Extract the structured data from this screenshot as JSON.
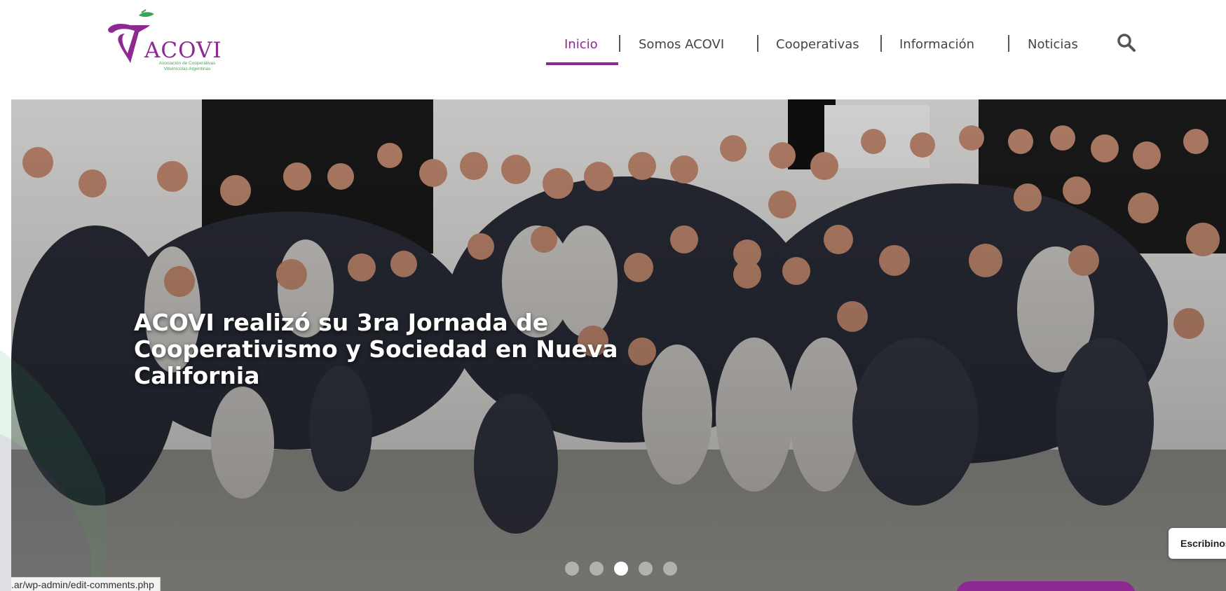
{
  "brand": {
    "name": "ACOVI",
    "subtitle_line1": "Asociación de Cooperativas",
    "subtitle_line2": "Vitivinícolas Argentinas",
    "accent_color": "#8d2a92",
    "leaf_color": "#3aa55a"
  },
  "nav": {
    "items": [
      {
        "label": "Inicio",
        "active": true
      },
      {
        "label": "Somos ACOVI",
        "active": false
      },
      {
        "label": "Cooperativas",
        "active": false
      },
      {
        "label": "Información",
        "active": false
      },
      {
        "label": "Noticias",
        "active": false
      }
    ],
    "separator": "|",
    "search_icon": "search-icon"
  },
  "hero": {
    "title": "ACOVI realizó su 3ra Jornada de Cooperativismo y Sociedad en Nueva California",
    "slides_total": 5,
    "active_slide": 3
  },
  "status_bar": {
    "url": ".ar/wp-admin/edit-comments.php"
  },
  "chat": {
    "label": "Escribinos"
  }
}
